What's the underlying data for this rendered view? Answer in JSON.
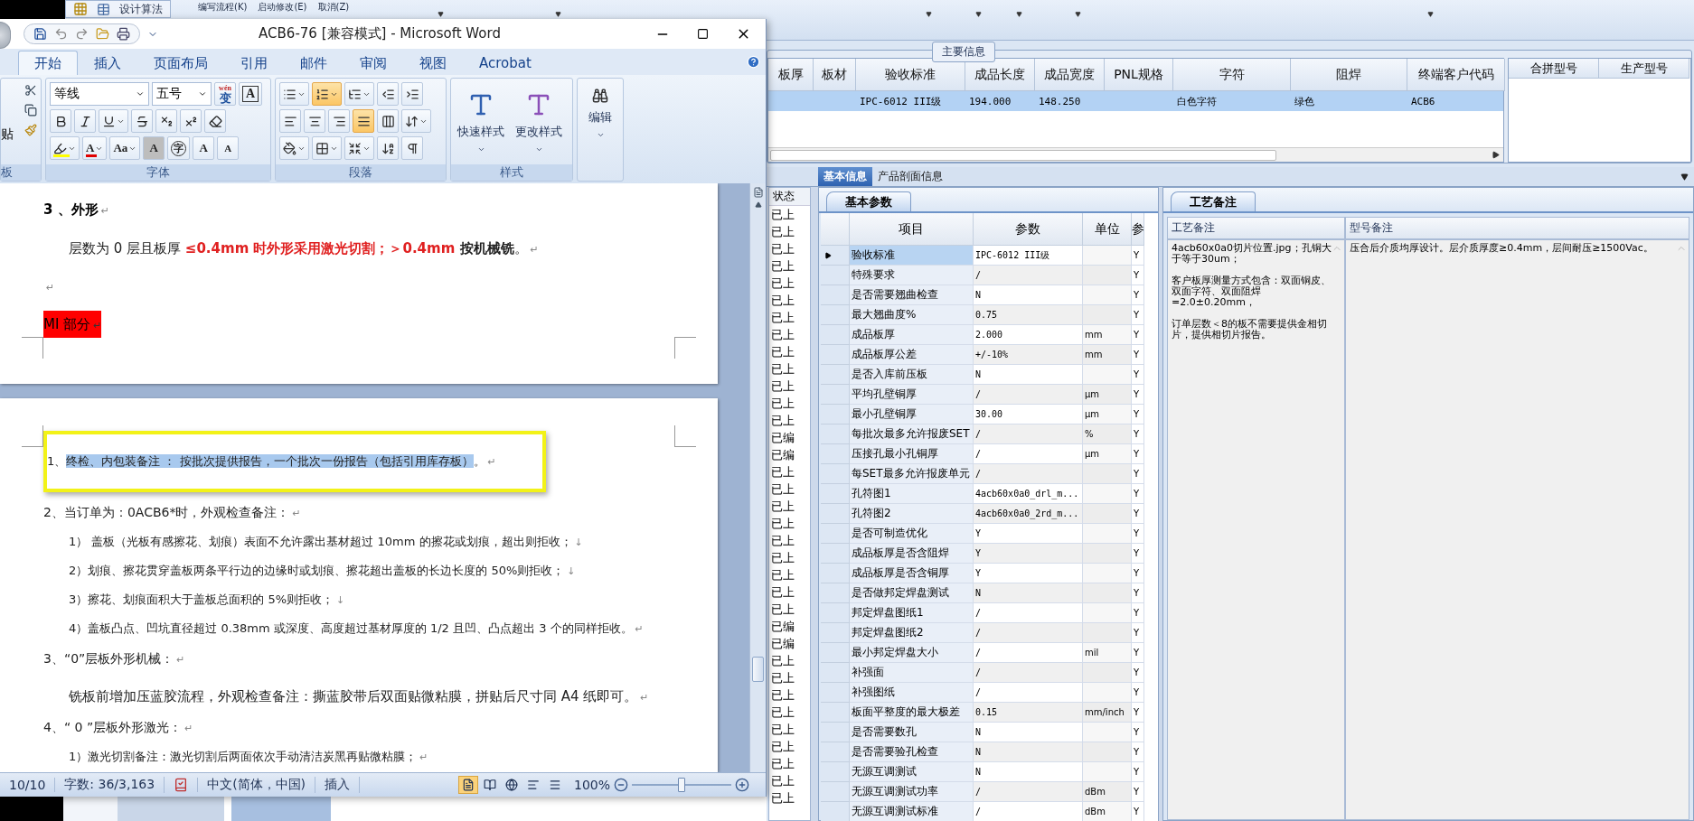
{
  "app": {
    "toolbar": {
      "button": "设计算法",
      "menu": [
        "编写流程(K)",
        "启动修改(E)",
        "取消(Z)"
      ]
    },
    "main_info": {
      "title": "主要信息",
      "columns": [
        "板厚",
        "板材",
        "验收标准",
        "成品长度",
        "成品宽度",
        "PNL规格",
        "字符",
        "阻焊",
        "终端客户代码"
      ],
      "rows": [
        {
          "selected": true,
          "cells": [
            null,
            null,
            "IPC-6012 III级",
            "194.000",
            "148.250",
            null,
            "白色字符",
            "绿色",
            "ACB6"
          ]
        }
      ],
      "side_columns": [
        "合拼型号",
        "生产型号"
      ]
    },
    "tabs": [
      {
        "label": "基本信息",
        "selected": true
      },
      {
        "label": "产品剖面信息",
        "selected": false
      }
    ],
    "status_list": {
      "header": "状态",
      "items": [
        "已上",
        "已上",
        "已上",
        "已上",
        "已上",
        "已上",
        "已上",
        "已上",
        "已上",
        "已上",
        "已上",
        "已上",
        "已上",
        "已编",
        "已编",
        "已上",
        "已上",
        "已上",
        "已上",
        "已上",
        "已上",
        "已上",
        "已上",
        "已上",
        "已编",
        "已编",
        "已上",
        "已上",
        "已上",
        "已上",
        "已上",
        "已上",
        "已上",
        "已上",
        "已上"
      ]
    },
    "params": {
      "tab": "基本参数",
      "columns": [
        "项目",
        "参数",
        "单位",
        "参"
      ],
      "rows": [
        {
          "item": "验收标准",
          "value": "IPC-6012 III级",
          "unit": null,
          "flag": "Y",
          "selected": true
        },
        {
          "item": "特殊要求",
          "value": "/",
          "unit": null,
          "flag": "Y",
          "selected": false
        },
        {
          "item": "是否需要翘曲检查",
          "value": "N",
          "unit": null,
          "flag": "Y",
          "selected": false
        },
        {
          "item": "最大翘曲度%",
          "value": "0.75",
          "unit": null,
          "flag": "Y",
          "selected": false
        },
        {
          "item": "成品板厚",
          "value": "2.000",
          "unit": "mm",
          "flag": "Y",
          "selected": false
        },
        {
          "item": "成品板厚公差",
          "value": "+/-10%",
          "unit": "mm",
          "flag": "Y",
          "selected": false
        },
        {
          "item": "是否入库前压板",
          "value": "N",
          "unit": null,
          "flag": "Y",
          "selected": false
        },
        {
          "item": "平均孔壁铜厚",
          "value": "/",
          "unit": "μm",
          "flag": "Y",
          "selected": false
        },
        {
          "item": "最小孔壁铜厚",
          "value": "30.00",
          "unit": "μm",
          "flag": "Y",
          "selected": false
        },
        {
          "item": "每批次最多允许报废SET",
          "value": "/",
          "unit": "%",
          "flag": "Y",
          "selected": false
        },
        {
          "item": "压接孔最小孔铜厚",
          "value": "/",
          "unit": "μm",
          "flag": "Y",
          "selected": false
        },
        {
          "item": "每SET最多允许报废单元",
          "value": "/",
          "unit": null,
          "flag": "Y",
          "selected": false
        },
        {
          "item": "孔符图1",
          "value": "4acb60x0a0_drl_m...",
          "unit": null,
          "flag": "Y",
          "selected": false
        },
        {
          "item": "孔符图2",
          "value": "4acb60x0a0_2rd_m...",
          "unit": null,
          "flag": "Y",
          "selected": false
        },
        {
          "item": "是否可制造优化",
          "value": "Y",
          "unit": null,
          "flag": "Y",
          "selected": false
        },
        {
          "item": "成品板厚是否含阻焊",
          "value": "Y",
          "unit": null,
          "flag": "Y",
          "selected": false
        },
        {
          "item": "成品板厚是否含铜厚",
          "value": "Y",
          "unit": null,
          "flag": "Y",
          "selected": false
        },
        {
          "item": "是否做邦定焊盘测试",
          "value": "N",
          "unit": null,
          "flag": "Y",
          "selected": false
        },
        {
          "item": "邦定焊盘图纸1",
          "value": "/",
          "unit": null,
          "flag": "Y",
          "selected": false
        },
        {
          "item": "邦定焊盘图纸2",
          "value": "/",
          "unit": null,
          "flag": "Y",
          "selected": false
        },
        {
          "item": "最小邦定焊盘大小",
          "value": "/",
          "unit": "mil",
          "flag": "Y",
          "selected": false
        },
        {
          "item": "补强面",
          "value": "/",
          "unit": null,
          "flag": "Y",
          "selected": false
        },
        {
          "item": "补强图纸",
          "value": "/",
          "unit": null,
          "flag": "Y",
          "selected": false
        },
        {
          "item": "板面平整度的最大极差",
          "value": "0.15",
          "unit": "mm/inch",
          "flag": "Y",
          "selected": false
        },
        {
          "item": "是否需要数孔",
          "value": "N",
          "unit": null,
          "flag": "Y",
          "selected": false
        },
        {
          "item": "是否需要验孔检查",
          "value": "N",
          "unit": null,
          "flag": "Y",
          "selected": false
        },
        {
          "item": "无源互调测试",
          "value": "N",
          "unit": null,
          "flag": "Y",
          "selected": false
        },
        {
          "item": "无源互调测试功率",
          "value": "/",
          "unit": "dBm",
          "flag": "Y",
          "selected": false
        },
        {
          "item": "无源互调测试标准",
          "value": "/",
          "unit": "dBm",
          "flag": "Y",
          "selected": false
        }
      ]
    },
    "notes": {
      "tab": "工艺备注",
      "columns": [
        {
          "title": "工艺备注",
          "paragraphs": [
            "4acb60x0a0切片位置.jpg；孔铜大于等于30um；",
            "客户板厚测量方式包含：双面铜皮、双面字符、双面阻焊=2.0±0.20mm，",
            "订单层数＜8的板不需要提供金相切片，提供相切片报告。"
          ]
        },
        {
          "title": "型号备注",
          "paragraphs": [
            "压合后介质均厚设计。层介质厚度≥0.4mm，层间耐压≥1500Vac。"
          ]
        }
      ]
    }
  },
  "word": {
    "title": "ACB6-76 [兼容模式] - Microsoft Word",
    "tabs": [
      {
        "label": "开始",
        "selected": true
      },
      {
        "label": "插入",
        "selected": false
      },
      {
        "label": "页面布局",
        "selected": false
      },
      {
        "label": "引用",
        "selected": false
      },
      {
        "label": "邮件",
        "selected": false
      },
      {
        "label": "审阅",
        "selected": false
      },
      {
        "label": "视图",
        "selected": false
      },
      {
        "label": "Acrobat",
        "selected": false
      }
    ],
    "clipboard": {
      "paste": "贴",
      "group": "板"
    },
    "font": {
      "name": "等线",
      "size": "五号",
      "group": "字体",
      "row1": [
        {
          "kind": "phonetic",
          "label": "变",
          "ruby": "wén"
        },
        {
          "kind": "boxed",
          "label": "A"
        }
      ],
      "row2": [
        {
          "kind": "bold"
        },
        {
          "kind": "italic"
        },
        {
          "kind": "underline"
        },
        {
          "kind": "strike"
        },
        {
          "kind": "subscript"
        },
        {
          "kind": "superscript"
        },
        {
          "kind": "clear"
        }
      ],
      "row3": [
        {
          "kind": "highlight"
        },
        {
          "kind": "fontcolor",
          "label": "A"
        },
        {
          "kind": "case",
          "label": "Aa"
        },
        {
          "kind": "shaded",
          "label": "A"
        },
        {
          "kind": "enclosed",
          "label": "字"
        },
        {
          "kind": "grow",
          "label": "A"
        },
        {
          "kind": "shrink",
          "label": "A"
        }
      ]
    },
    "paragraph": {
      "group": "段落",
      "rows": [
        [
          {
            "kind": "bullets",
            "selected": false
          },
          {
            "kind": "numbering",
            "selected": true
          },
          {
            "kind": "multilevel",
            "selected": false
          },
          {
            "kind": "outdent",
            "selected": false
          },
          {
            "kind": "indent",
            "selected": false
          }
        ],
        [
          {
            "kind": "left",
            "selected": false
          },
          {
            "kind": "center",
            "selected": false
          },
          {
            "kind": "right",
            "selected": false
          },
          {
            "kind": "justify",
            "selected": true
          },
          {
            "kind": "distribute",
            "selected": false
          },
          {
            "kind": "spacing",
            "selected": false
          }
        ],
        [
          {
            "kind": "shading",
            "selected": false
          },
          {
            "kind": "borders",
            "selected": false
          },
          {
            "kind": "asian",
            "selected": false
          },
          {
            "kind": "sort",
            "selected": false
          },
          {
            "kind": "marks",
            "selected": false
          }
        ]
      ]
    },
    "styles": {
      "group": "样式",
      "items": [
        "快速样式",
        "更改样式"
      ]
    },
    "editing": {
      "label": "编辑"
    },
    "page1": [
      {
        "kind": "heading",
        "text": "3 、外形",
        "mark": "↵"
      },
      {
        "kind": "mixed",
        "segments": [
          {
            "kind": "plain",
            "text": "层数为 0 层且板厚 "
          },
          {
            "kind": "warning",
            "text": "≤0.4mm  时外形采用激光切割；＞0.4mm "
          },
          {
            "kind": "strong",
            "text": "按机械铣"
          },
          {
            "kind": "plain",
            "text": "。"
          }
        ],
        "mark": "↵"
      },
      {
        "kind": "empty",
        "mark": "↵"
      },
      {
        "kind": "label",
        "text": "MI 部分",
        "mark": "↵"
      }
    ],
    "page2": [
      {
        "kind": "callout",
        "number": "1、",
        "text": "终检、内包装备注 ： 按批次提供报告，一个批次一份报告（包括引用库存板）",
        "tail": "。",
        "mark": "↵"
      },
      {
        "kind": "item",
        "text": "2、当订单为：0ACB6*时，外观检查备注：",
        "mark": "↵"
      },
      {
        "kind": "sub",
        "text": "1）  盖板（光板有感擦花、划痕）表面不允许露出基材超过 10mm 的擦花或划痕，超出则拒收；",
        "mark": "↓"
      },
      {
        "kind": "sub",
        "text": "2）划痕、擦花贯穿盖板两条平行边的边缘时或划痕、擦花超出盖板的长边长度的 50%则拒收；",
        "mark": "↓"
      },
      {
        "kind": "sub",
        "text": "3）擦花、划痕面积大于盖板总面积的 5%则拒收；",
        "mark": "↓"
      },
      {
        "kind": "sub",
        "text": "4）盖板凸点、凹坑直径超过 0.38mm 或深度、高度超过基材厚度的 1/2 且凹、凸点超出 3 个的同样拒收。",
        "mark": "↵"
      },
      {
        "kind": "item",
        "text": "3、“0”层板外形机械：",
        "mark": "↵"
      },
      {
        "kind": "para",
        "text": "铣板前增加压蓝胶流程，外观检查备注：撕蓝胶带后双面贴微粘膜，拼贴后尺寸同 A4 纸即可。",
        "mark": "↵"
      },
      {
        "kind": "item",
        "text": "4、“ 0 ”层板外形激光：",
        "mark": "↵"
      },
      {
        "kind": "sub",
        "text": "1）激光切割备注：激光切割后两面依次手动清洁炭黑再贴微粘膜；",
        "mark": "↵"
      }
    ],
    "status_bar": {
      "page": "10/10",
      "words": "字数: 36/3,163",
      "language": "中文(简体，中国)",
      "mode": "插入",
      "zoom": {
        "label": "100%",
        "level": 0.5
      }
    }
  }
}
